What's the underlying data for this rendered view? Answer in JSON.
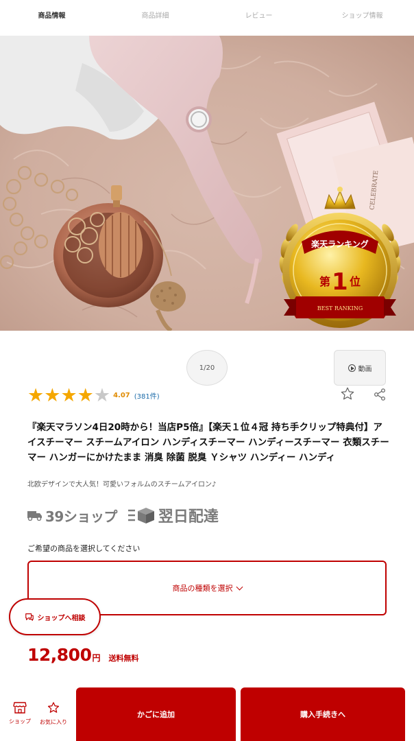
{
  "tabs": [
    {
      "label": "商品情報"
    },
    {
      "label": "商品詳細"
    },
    {
      "label": "レビュー"
    },
    {
      "label": "ショップ情報"
    }
  ],
  "hero": {
    "badge_rank_text": "楽天ランキング",
    "badge_place_prefix": "第",
    "badge_place_number": "1",
    "badge_place_suffix": "位",
    "badge_ribbon": "BEST RANKING",
    "card_text": "CELEBRATE"
  },
  "gallery": {
    "counter": "1/20",
    "video_label": "動画"
  },
  "rating": {
    "stars_filled": 4,
    "stars_total": 5,
    "score": "4.07",
    "count": "(381件)"
  },
  "product": {
    "title": "『楽天マラソン4日20時から！当店P5倍』【楽天１位４冠 持ち手クリップ特典付】アイスチーマー スチームアイロン ハンディスチーマー ハンディースチーマー 衣類スチーマー ハンガーにかけたまま 消臭 除菌 脱臭 Ｙシャツ ハンディー ハンディ",
    "catch_copy": "北欧デザインで大人気！可愛いフォルムのスチームアイロン♪"
  },
  "shipping": {
    "badge_39": "39ショップ",
    "badge_next_day": "翌日配達"
  },
  "selection": {
    "label": "ご希望の商品を選択してください",
    "dropdown": "商品の種類を選択"
  },
  "consult_button": "ショップへ相談",
  "price": {
    "amount": "12,800",
    "unit": "円",
    "shipping_note": "送料無料"
  },
  "bottom_bar": {
    "shop_label": "ショップ",
    "favorite_label": "お気に入り",
    "cart_label": "かごに追加",
    "buy_label": "購入手続きへ"
  },
  "colors": {
    "accent": "#bf0000",
    "star": "#f5a700",
    "link": "#1a6aa8"
  }
}
